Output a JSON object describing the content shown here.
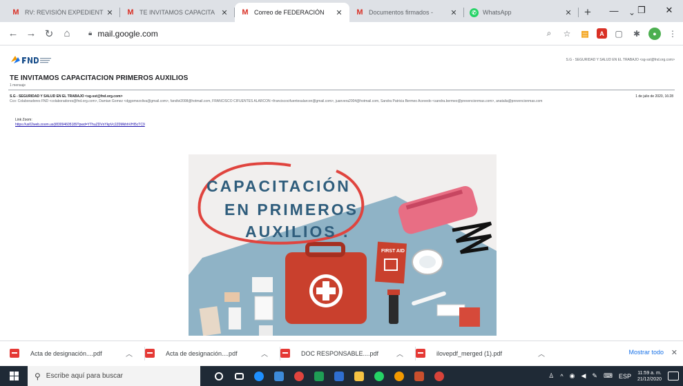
{
  "browser": {
    "tabs": [
      {
        "label": "RV: REVISIÓN EXPEDIENT",
        "icon": "gmail-icon",
        "active": false
      },
      {
        "label": "TE INVITAMOS CAPACITA",
        "icon": "gmail-icon",
        "active": false
      },
      {
        "label": "Correo de FEDERACIÓN",
        "icon": "gmail-icon",
        "active": true
      },
      {
        "label": "Documentos firmados -",
        "icon": "gmail-icon",
        "active": false
      },
      {
        "label": "WhatsApp",
        "icon": "whatsapp-icon",
        "active": false
      }
    ],
    "new_tab_glyph": "+",
    "url": "mail.google.com"
  },
  "email": {
    "header_sender": "S.G - SEGURIDAD Y SALUD EN EL TRABAJO <sg-sst@fnd.org.com>",
    "subject": "TE INVITAMOS CAPACITACION PRIMEROS AUXILIOS",
    "message_count": "1 mensaje",
    "from": "S.G - SEGURIDAD Y SALUD EN EL TRABAJO <sg-sst@fnd.org.com>",
    "date": "1 de julio de 2020, 16:28",
    "cc": "Cco: Colaboradores FND <colaboradores@fnd.org.com>, Damian Gomez <dggomezoliva@gmail.com>, fandivi2008@hotmail.com, FRANCISCO CIFUENTES ALARCON <franciscocifuentesalarcon@gmail.com>, juanvera2004@hotmail.com, Sandra Patricia Bermeo Acevedo <sandra.bermeo@prevencionmas.com>, anatalia@prevencionmas.com",
    "link_label": "Link Zoom:",
    "link_url": "https://us02web.zoom.us/j/83094605189?pwd=YThuZDVnYkpVc2Z0MkhhVHI5cTC9"
  },
  "poster": {
    "line1": "CAPACITACIÓN",
    "line2": "EN PRIMEROS",
    "line3": "AUXILIOS .",
    "kit_label": "FIRST AID"
  },
  "downloads": {
    "items": [
      {
        "name": "Acta de designación....pdf"
      },
      {
        "name": "Acta de designación....pdf"
      },
      {
        "name": "DOC RESPONSABLE....pdf"
      },
      {
        "name": "ilovepdf_merged (1).pdf"
      }
    ],
    "show_all": "Mostrar todo"
  },
  "taskbar": {
    "search_placeholder": "Escribe aquí para buscar",
    "lang": "ESP",
    "time": "11:59 a. m.",
    "date": "21/12/2020"
  },
  "colors": {
    "accent": "#1a73e8",
    "gmail": "#d93025",
    "poster_title": "#2f5d7c",
    "poster_circle": "#e0443e",
    "board": "#8fb3c6",
    "taskbar": "#1f2a36"
  }
}
